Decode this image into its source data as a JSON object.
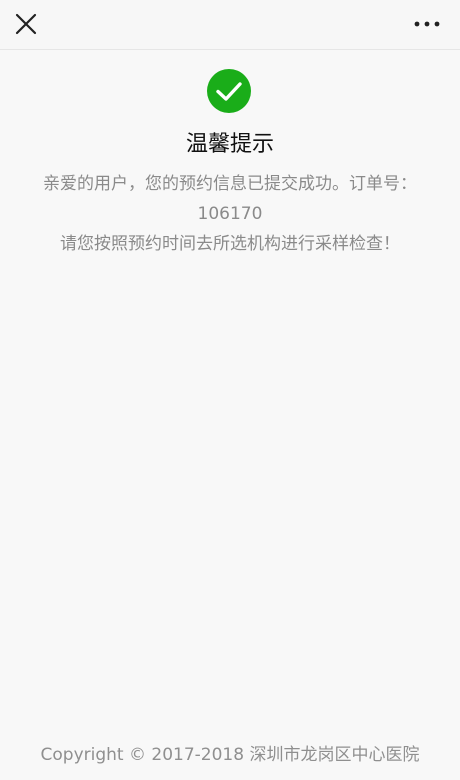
{
  "icons": {
    "close": "close-icon",
    "more": "more-icon",
    "success": "check-circle-icon"
  },
  "colors": {
    "success_green": "#1aad19",
    "title_text": "#111111",
    "message_text": "#8a8a8a"
  },
  "content": {
    "title": "温馨提示",
    "message_line1": "亲爱的用户，您的预约信息已提交成功。订单号：",
    "order_number": "106170",
    "message_line3": "请您按照预约时间去所选机构进行采样检查！"
  },
  "footer": {
    "copyright": "Copyright © 2017-2018 深圳市龙岗区中心医院"
  }
}
